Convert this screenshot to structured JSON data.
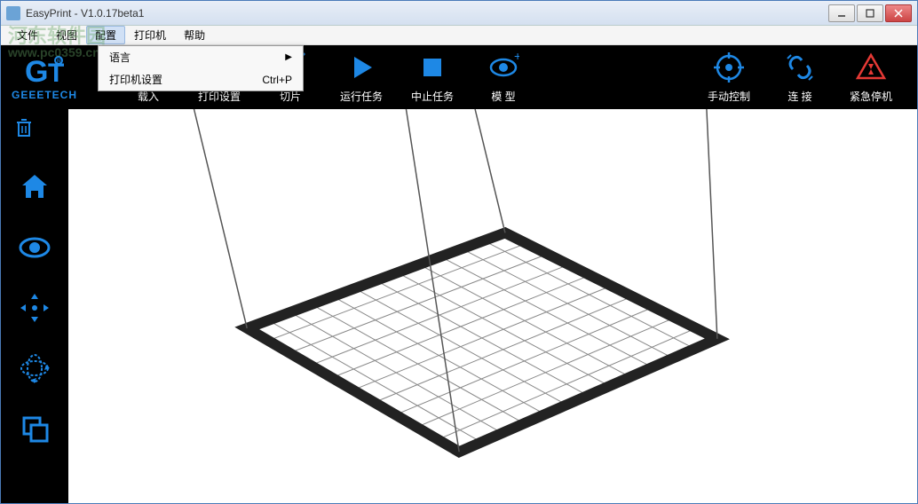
{
  "window": {
    "title": "EasyPrint - V1.0.17beta1"
  },
  "menu": {
    "file": "文件",
    "view": "视图",
    "config": "配置",
    "printer": "打印机",
    "help": "帮助"
  },
  "dropdown": {
    "language": "语言",
    "printer_settings": "打印机设置",
    "printer_settings_shortcut": "Ctrl+P"
  },
  "toolbar": {
    "logo": "GEEETECH",
    "load": "载入",
    "print_settings": "打印设置",
    "slice": "切片",
    "run_task": "运行任务",
    "stop_task": "中止任务",
    "model": "模 型",
    "manual_control": "手动控制",
    "connect": "连 接",
    "emergency_stop": "紧急停机"
  },
  "watermark": {
    "text": "河东软件园",
    "url": "www.pc0359.cn"
  }
}
